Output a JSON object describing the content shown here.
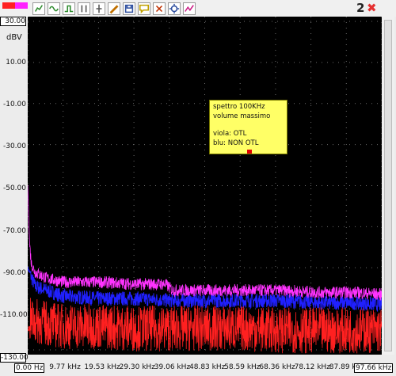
{
  "toolbar": {
    "buttons": [
      {
        "name": "chart-icon",
        "color": "#2e8b2e"
      },
      {
        "name": "waveform-icon",
        "color": "#2e8b2e"
      },
      {
        "name": "step-icon",
        "color": "#2e8b2e"
      },
      {
        "name": "cursor-icon",
        "color": "#555555"
      },
      {
        "name": "marker-icon",
        "color": "#555555"
      },
      {
        "name": "pencil-icon",
        "color": "#c07000"
      },
      {
        "name": "save-icon",
        "color": "#3050a0"
      },
      {
        "name": "comment-icon",
        "color": "#c0a000"
      },
      {
        "name": "zoom-out-icon",
        "color": "#c03000"
      },
      {
        "name": "settings-icon",
        "color": "#3050a0"
      },
      {
        "name": "trend-icon",
        "color": "#cc2288"
      }
    ],
    "page_number": "2",
    "close_symbol": "✖"
  },
  "y_axis": {
    "unit": "dBV",
    "labels": [
      "30.00",
      "10.00",
      "-10.00",
      "-30.00",
      "-50.00",
      "-70.00",
      "-90.00",
      "-110.00",
      "-130.00"
    ]
  },
  "x_axis": {
    "labels": [
      "0.00 Hz",
      "9.77 kHz",
      "19.53 kHz",
      "29.30 kHz",
      "39.06 kHz",
      "48.83 kHz",
      "58.59 kHz",
      "68.36 kHz",
      "78.12 kHz",
      "87.89 kHz",
      "97.66 kHz"
    ]
  },
  "note": {
    "line1": "spettro 100KHz",
    "line2": "volume massimo",
    "line3": "viola: OTL",
    "line4": "blu: NON OTL"
  },
  "chart_data": {
    "type": "line",
    "ylabel": "dBV",
    "ylim": [
      -130,
      30
    ],
    "xlim": [
      0,
      97.66
    ],
    "x_tick_labels": [
      "0.00 Hz",
      "9.77 kHz",
      "19.53 kHz",
      "29.30 kHz",
      "39.06 kHz",
      "48.83 kHz",
      "58.59 kHz",
      "68.36 kHz",
      "78.12 kHz",
      "87.89 kHz",
      "97.66 kHz"
    ],
    "y_tick_labels": [
      "30.00",
      "10.00",
      "-10.00",
      "-30.00",
      "-50.00",
      "-70.00",
      "-90.00",
      "-110.00",
      "-130.00"
    ],
    "grid": true,
    "series": [
      {
        "name": "viola: OTL",
        "color": "#ff33ff",
        "points": [
          [
            0,
            -50
          ],
          [
            0.5,
            -78
          ],
          [
            1,
            -88
          ],
          [
            2,
            -92
          ],
          [
            5,
            -95
          ],
          [
            10,
            -97
          ],
          [
            20,
            -97
          ],
          [
            30,
            -98
          ],
          [
            38,
            -98
          ],
          [
            40,
            -101
          ],
          [
            50,
            -101
          ],
          [
            60,
            -101
          ],
          [
            70,
            -101
          ],
          [
            80,
            -102
          ],
          [
            90,
            -102
          ],
          [
            97.66,
            -103
          ]
        ]
      },
      {
        "name": "blu: NON OTL",
        "color": "#2020ff",
        "points": [
          [
            0,
            -90
          ],
          [
            2,
            -99
          ],
          [
            10,
            -104
          ],
          [
            20,
            -105
          ],
          [
            30,
            -105
          ],
          [
            40,
            -106
          ],
          [
            50,
            -106
          ],
          [
            60,
            -106
          ],
          [
            70,
            -106
          ],
          [
            80,
            -107
          ],
          [
            90,
            -107
          ],
          [
            97.66,
            -108
          ]
        ]
      },
      {
        "color": "#ff2020",
        "points": [
          [
            0,
            -120
          ],
          [
            10,
            -123
          ],
          [
            20,
            -123
          ],
          [
            30,
            -124
          ],
          [
            40,
            -124
          ],
          [
            50,
            -124
          ],
          [
            60,
            -124
          ],
          [
            70,
            -125
          ],
          [
            80,
            -125
          ],
          [
            90,
            -125
          ],
          [
            97.66,
            -125
          ]
        ]
      }
    ]
  }
}
